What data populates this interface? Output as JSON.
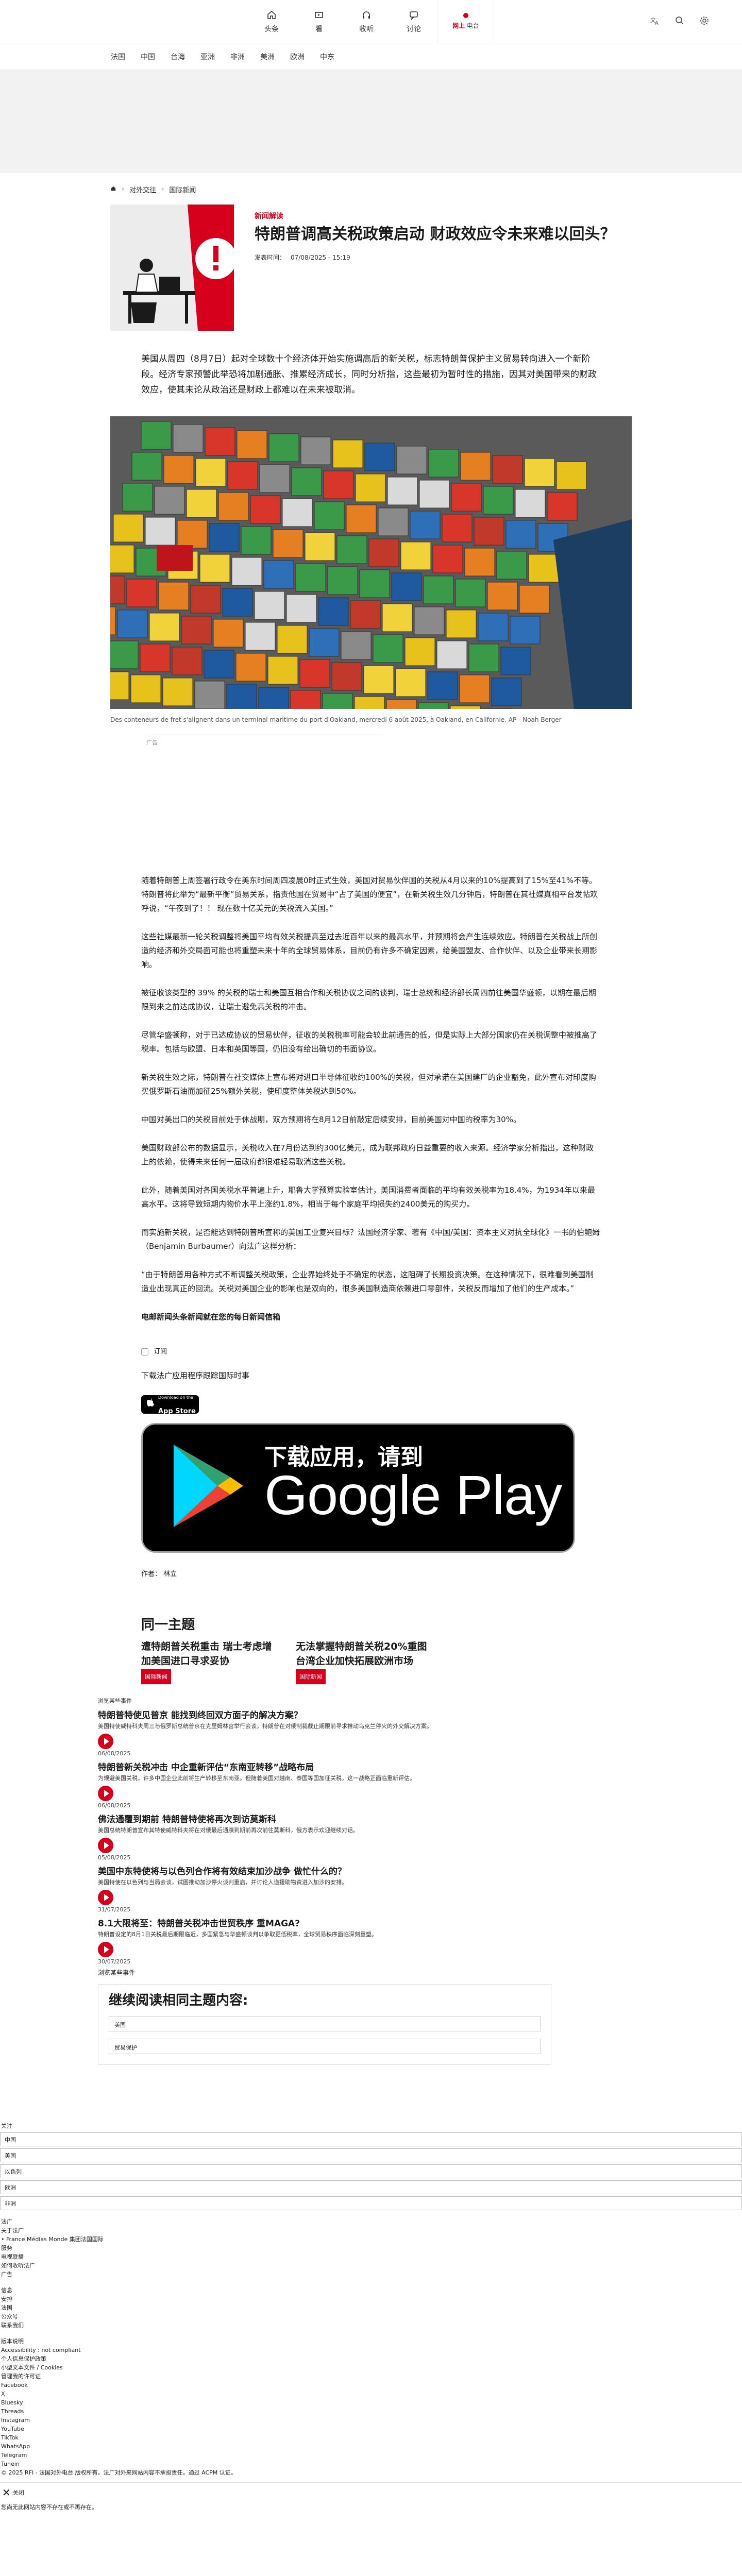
{
  "topnav": {
    "items": [
      {
        "label": "头条",
        "icon": "home-icon"
      },
      {
        "label": "看",
        "icon": "watch-icon"
      },
      {
        "label": "收听",
        "icon": "listen-icon"
      },
      {
        "label": "讨论",
        "icon": "debate-icon"
      }
    ],
    "live": {
      "prefix": "网上",
      "label": "电台"
    },
    "right_icons": [
      "translate-icon",
      "search-icon",
      "settings-icon"
    ]
  },
  "subnav": [
    "法国",
    "中国",
    "台海",
    "亚洲",
    "非洲",
    "美洲",
    "欧洲",
    "中东"
  ],
  "breadcrumb": [
    "头条",
    "对外交往",
    "国际新闻"
  ],
  "article": {
    "kicker": "新闻解读",
    "title": "特朗普调高关税政策启动 财政效应令未来难以回头？",
    "published_label": "发表时间：",
    "published": "07/08/2025 - 15:19",
    "lead": "美国从周四（8月7日）起对全球数十个经济体开始实施调高后的新关税，标志特朗普保护主义贸易转向进入一个新阶段。经济专家预警此举恐将加剧通胀、推累经济成长，同时分析指，这些最初为暂时性的措施，因其对美国带来的财政效应，使其未论从政治还是财政上都难以在未来被取消。",
    "caption": "Des conteneurs de fret s'alignent dans un terminal maritime du port d'Oakland, mercredi 6 août 2025, à Oakland, en Californie. AP - Noah Berger",
    "ad_label": "广告",
    "paragraphs": [
      "随着特朗普上周签署行政令在美东时间周四凌晨0时正式生效，美国对贸易伙伴国的关税从4月以来的10%提高到了15%至41%不等。特朗普将此举为“最新平衡”贸易关系，指责他国在贸易中“占了美国的便宜”，在新关税生效几分钟后，特朗普在其社媒真相平台发帖欢呼说，“午夜到了！！ 现在数十亿美元的关税流入美国。”",
      "这些社媒最新一轮关税调整将美国平均有效关税提高至过去近百年以来的最高水平，并预期将会产生连续效应。特朗普在关税战上所创造的经济和外交局面可能也将重塑未来十年的全球贸易体系，目前仍有许多不确定因素，给美国盟友、合作伙伴、以及企业带来长期影响。",
      "被征收该类型的 39% 的关税的瑞士和美国互相合作和关税协议之间的谈判，瑞士总统和经济部长周四前往美国华盛顿，以期在最后期限到来之前达成协议，让瑞士避免高关税的冲击。",
      "尽管华盛顿称，对于已达成协议的贸易伙伴，征收的关税税率可能会较此前通告的低，但是实际上大部分国家仍在关税调整中被推高了税率。包括与欧盟、日本和英国等国，仍旧没有给出确切的书面协议。",
      "新关税生效之际，特朗普在社交媒体上宣布将对进口半导体征收约100%的关税，但对承诺在美国建厂的企业豁免，此外宣布对印度购买俄罗斯石油而加征25%额外关税，使印度整体关税达到50%。",
      "中国对美出口的关税目前处于休战期，双方预期将在8月12日前敲定后续安排，目前美国对中国的税率为30%。",
      "美国财政部公布的数据显示，关税收入在7月份达到约300亿美元，成为联邦政府日益重要的收入来源。经济学家分析指出，这种财政上的依赖，使得未来任何一届政府都很难轻易取消这些关税。",
      "此外，随着美国对各国关税水平普遍上升，耶鲁大学预算实验室估计，美国消费者面临的平均有效关税率为18.4%，为1934年以来最高水平。这将导致短期内物价水平上涨约1.8%，相当于每个家庭平均损失约2400美元的购买力。",
      "而实施新关税，是否能达到特朗普所宣称的美国工业复兴目标？法国经济学家、著有《中国/美国：资本主义对抗全球化》一书的伯鲍姆（Benjamin Burbaumer）向法广这样分析：",
      "“由于特朗普用各种方式不断调整关税政策，企业界始终处于不确定的状态，这阻碍了长期投资决策。在这种情况下，很难看到美国制造业出现真正的回流。关税对美国企业的影响也是双向的，很多美国制造商依赖进口零部件，关税反而增加了他们的生产成本。”",
      "电邮新闻头条新闻就在您的每日新闻信箱"
    ],
    "subscribe_label": "订阅",
    "download_text": "下载法广应用程序跟踪国际时事",
    "appstore_small": "Download on the",
    "appstore_big": "App Store",
    "gplay_small": "下载应用，请到",
    "gplay_big": "Google Play",
    "author": "作者：  林立"
  },
  "same_topic": {
    "heading": "同一主题",
    "items": [
      {
        "title": "遭特朗普关税重击 瑞士考虑增加美国进口寻求妥协",
        "tag": "国际新闻"
      },
      {
        "title": "无法掌握特朗普关税20%重图 台湾企业加快拓展欧洲市场",
        "tag": "国际新闻"
      }
    ]
  },
  "most_read": {
    "heading": "浏览某些事件",
    "items": [
      {
        "title": "特朗普特使见普京 能找到终回双方面子的解决方案？",
        "desc": "美国特使威特科夫周三与俄罗斯总统普京在克里姆林宫举行会谈，特朗普在对俄制裁截止期限前寻求推动乌克兰停火的外交解决方案。",
        "date": "06/08/2025"
      },
      {
        "title": "特朗普新关税冲击 中企重新评估“东南亚转移”战略布局",
        "desc": "为规避美国关税，许多中国企业此前将生产转移至东南亚。但随着美国对越南、泰国等国加征关税，这一战略正面临重新评估。",
        "date": "06/08/2025"
      },
      {
        "title": "佛法通覆到期前 特朗普特使将再次到访莫斯科",
        "desc": "美国总统特朗普宣布其特使威特科夫将在对俄最后通牒到期前再次前往莫斯科，俄方表示欢迎继续对话。",
        "date": "05/08/2025"
      },
      {
        "title": "美国中东特使将与以色列合作将有效结束加沙战争 做忙什么的？",
        "desc": "美国特使在以色列与当局会谈，试图推动加沙停火谈判重启，并讨论人道援助物资进入加沙的安排。",
        "date": "31/07/2025"
      },
      {
        "title": "8.1大限将至：特朗普关税冲击世贸秩序 重MAGA?",
        "desc": "特朗普设定的8月1日关税最后期限临近，多国紧急与华盛顿谈判以争取更低税率，全球贸易秩序面临深刻重塑。",
        "date": "30/07/2025"
      }
    ],
    "more_label": "浏览某些事件"
  },
  "related": {
    "heading": "继续阅读相同主题内容:",
    "items": [
      "美国",
      "贸易保护"
    ]
  },
  "footer": {
    "lines_a": [
      "关注",
      "中国",
      "美国",
      "以色列",
      "欧洲",
      "非洲"
    ],
    "lines_b": [
      "法广",
      "关于法广",
      "• France Médias Monde 集团法国国际",
      "服务",
      "电视联播",
      "如何收听法广",
      "广告"
    ],
    "lines_c": [
      "信息",
      "安排",
      "法国",
      "公众号",
      "联系我们"
    ],
    "lines_d": [
      "版本说明",
      "Accessibility : not compliant",
      "个人信息保护政策",
      "小型文本文件 / Cookies",
      "管理我的许可证",
      "Facebook",
      "X",
      "Bluesky",
      "Threads",
      "Instagram",
      "YouTube",
      "TikTok",
      "WhatsApp",
      "Telegram",
      "Tunein"
    ],
    "copyright": "© 2025 RFI - 法国对外电台 版权所有。法广对外来网站内容不承担责任。通过 ACPM 认证。",
    "close_label": "关闭",
    "bottom_note": "您尚无此网站内容不存在或不再存在。"
  },
  "colors": {
    "accent": "#d6001c"
  }
}
